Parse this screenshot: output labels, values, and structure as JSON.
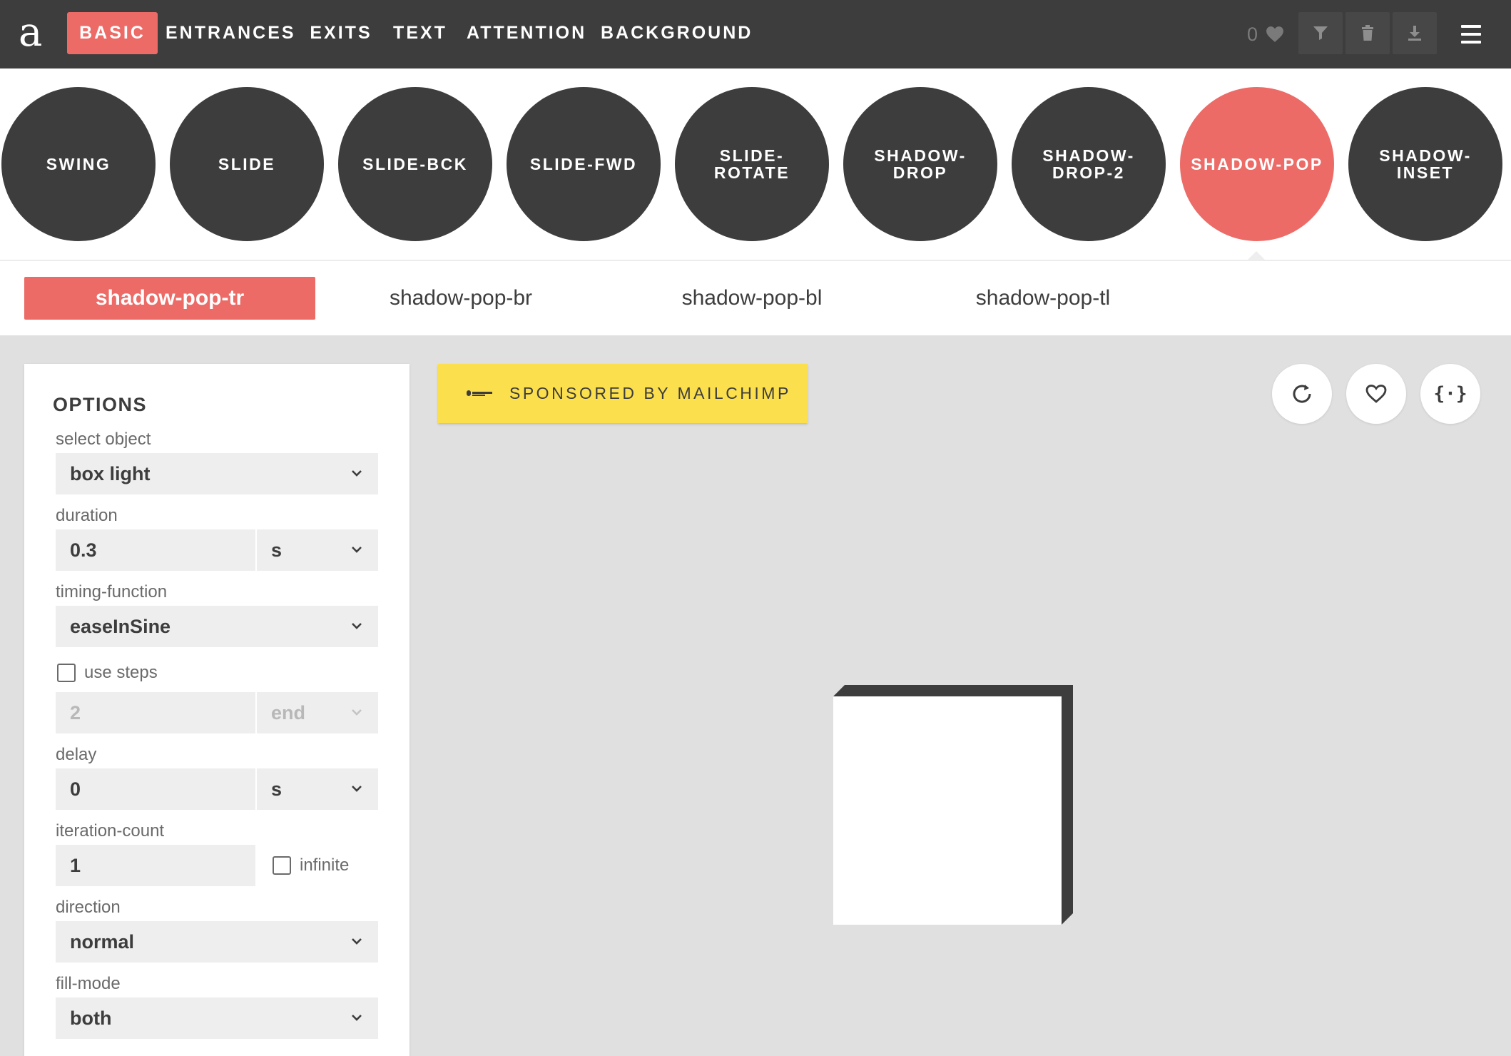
{
  "app": {
    "logo": "a"
  },
  "nav": {
    "tabs": [
      {
        "label": "BASIC",
        "active": true
      },
      {
        "label": "ENTRANCES",
        "active": false
      },
      {
        "label": "EXITS",
        "active": false
      },
      {
        "label": "TEXT",
        "active": false
      },
      {
        "label": "ATTENTION",
        "active": false
      },
      {
        "label": "BACKGROUND",
        "active": false
      }
    ],
    "favorites_count": "0",
    "tools": [
      "filter-icon",
      "trash-icon",
      "download-icon",
      "menu-icon"
    ]
  },
  "animations": [
    {
      "label": "SWING",
      "active": false
    },
    {
      "label": "SLIDE",
      "active": false
    },
    {
      "label": "SLIDE-BCK",
      "active": false
    },
    {
      "label": "SLIDE-FWD",
      "active": false
    },
    {
      "label": "SLIDE-ROTATE",
      "active": false
    },
    {
      "label": "SHADOW-DROP",
      "active": false
    },
    {
      "label": "SHADOW-DROP-2",
      "active": false
    },
    {
      "label": "SHADOW-POP",
      "active": true
    },
    {
      "label": "SHADOW-INSET",
      "active": false
    }
  ],
  "variants": [
    {
      "label": "shadow-pop-tr",
      "active": true
    },
    {
      "label": "shadow-pop-br",
      "active": false
    },
    {
      "label": "shadow-pop-bl",
      "active": false
    },
    {
      "label": "shadow-pop-tl",
      "active": false
    }
  ],
  "options": {
    "title": "OPTIONS",
    "select_object": {
      "label": "select object",
      "value": "box light"
    },
    "duration": {
      "label": "duration",
      "value": "0.3",
      "unit": "s"
    },
    "timing_function": {
      "label": "timing-function",
      "value": "easeInSine"
    },
    "use_steps": {
      "label": "use steps",
      "checked": false,
      "value": "2",
      "position": "end"
    },
    "delay": {
      "label": "delay",
      "value": "0",
      "unit": "s"
    },
    "iteration_count": {
      "label": "iteration-count",
      "value": "1",
      "infinite_label": "infinite",
      "infinite_checked": false
    },
    "direction": {
      "label": "direction",
      "value": "normal"
    },
    "fill_mode": {
      "label": "fill-mode",
      "value": "both"
    }
  },
  "sponsor": {
    "text": "SPONSORED BY MAILCHIMP"
  },
  "actions": {
    "code_label": "{·}",
    "icons": [
      "replay-icon",
      "heart-icon",
      "code-icon"
    ]
  },
  "colors": {
    "accent": "#ec6b67",
    "dark": "#3d3d3d",
    "canvas": "#e0e0e0",
    "sponsor": "#fbdf4d"
  }
}
